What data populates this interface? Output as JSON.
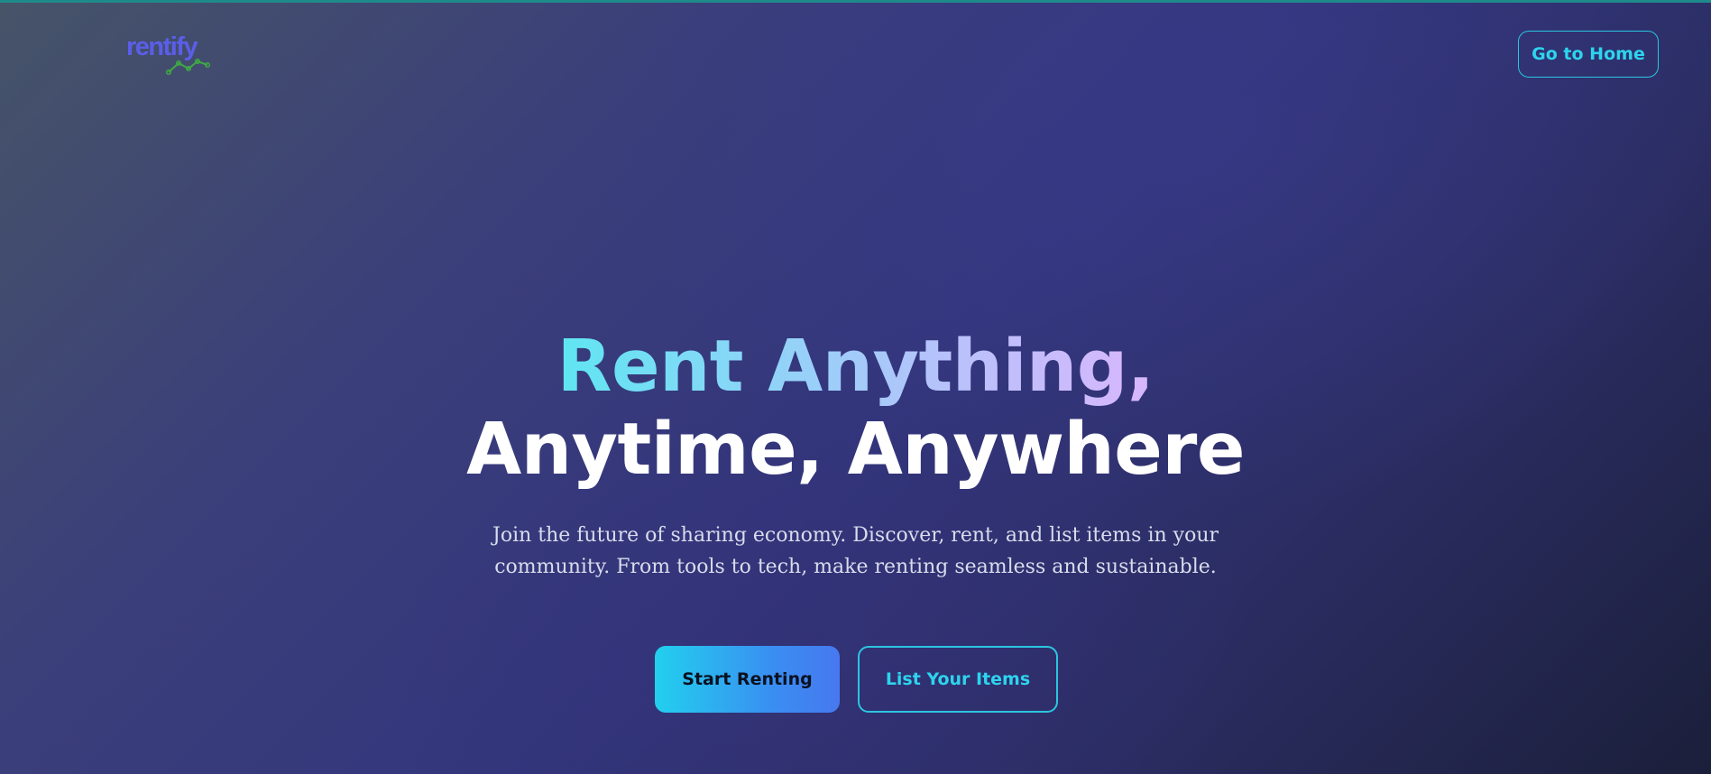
{
  "brand": {
    "logo_text": "rentify",
    "logo_icon": "trend-line-icon",
    "logo_color": "#5b5ee8",
    "logo_graph_color": "#3fa845"
  },
  "header": {
    "home_button_label": "Go to Home"
  },
  "hero": {
    "title_line1": "Rent Anything,",
    "title_line2": "Anytime, Anywhere",
    "subtitle_line1": "Join the future of sharing economy. Discover, rent, and list items in your",
    "subtitle_line2": "community. From tools to tech, make renting seamless and sustainable."
  },
  "actions": {
    "primary_label": "Start Renting",
    "secondary_label": "List Your Items"
  },
  "colors": {
    "accent": "#2dd4ee",
    "primary_gradient_start": "#22d0ee",
    "primary_gradient_end": "#4778ef",
    "title_gradient_start": "#5fe6f2",
    "title_gradient_end": "#d8b6fc"
  }
}
